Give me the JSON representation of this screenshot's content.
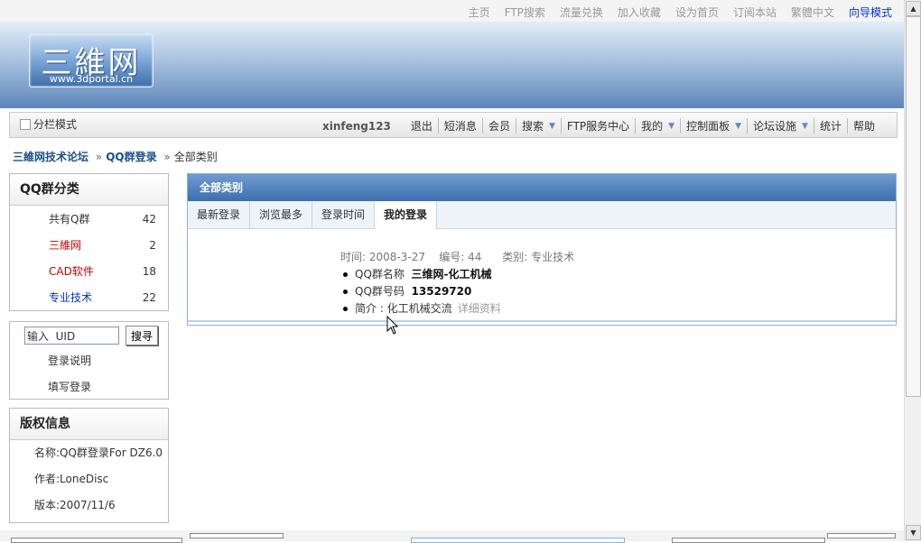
{
  "top_links": [
    "主页",
    "FTP搜索",
    "流量兑换",
    "加入收藏",
    "设为首页",
    "订阅本站",
    "繁體中文",
    "向导模式"
  ],
  "logo": {
    "main": "三維网",
    "sub": "www.3dportal.cn"
  },
  "navbar": {
    "split_mode": "分栏模式",
    "username": "xinfeng123",
    "items": [
      {
        "label": "退出",
        "dropdown": false
      },
      {
        "label": "短消息",
        "dropdown": false
      },
      {
        "label": "会员",
        "dropdown": false
      },
      {
        "label": "搜索",
        "dropdown": true
      },
      {
        "label": "FTP服务中心",
        "dropdown": false
      },
      {
        "label": "我的",
        "dropdown": true
      },
      {
        "label": "控制面板",
        "dropdown": true
      },
      {
        "label": "论坛设施",
        "dropdown": true
      },
      {
        "label": "统计",
        "dropdown": false
      },
      {
        "label": "帮助",
        "dropdown": false
      }
    ]
  },
  "breadcrumb": {
    "forum": "三維网技术论坛",
    "sep": "»",
    "module": "QQ群登录",
    "current": "全部类别"
  },
  "qq_groups": {
    "title": "QQ群分类",
    "items": [
      {
        "label": "共有Q群",
        "count": "42",
        "color": "#333333"
      },
      {
        "label": "三維网",
        "count": "2",
        "color": "#cc0000"
      },
      {
        "label": "CAD软件",
        "count": "18",
        "color": "#cc0000"
      },
      {
        "label": "专业技术",
        "count": "22",
        "color": "#0033cc"
      }
    ]
  },
  "search": {
    "value": "输入  UID",
    "button": "搜寻",
    "links": [
      "登录说明",
      "填写登录"
    ]
  },
  "copyright": {
    "title": "版权信息",
    "rows": [
      "名称:QQ群登录For DZ6.0",
      "作者:LoneDisc",
      "版本:2007/11/6"
    ]
  },
  "panel": {
    "title": "全部类别",
    "tabs": [
      "最新登录",
      "浏览最多",
      "登录时间",
      "我的登录"
    ],
    "active_tab": 3,
    "entry": {
      "meta": "时间: 2008-3-27    编号: 44      类别: 专业技术",
      "name_label": "QQ群名称",
      "name_value": "三维网-化工机械",
      "number_label": "QQ群号码",
      "number_value": "13529720",
      "intro_label": "简介 : 化工机械交流",
      "more": "详细资料"
    }
  },
  "icons": {
    "dropdown": "chevron-down-icon",
    "cursor": "mouse-pointer-icon"
  }
}
